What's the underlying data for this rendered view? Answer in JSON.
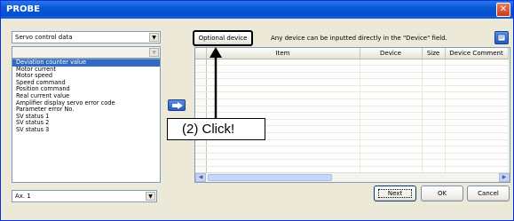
{
  "window": {
    "title": "PROBE",
    "close_glyph": "✕"
  },
  "left": {
    "category_combo": "Servo control data",
    "filter_combo": "",
    "items": [
      "Deviation counter value",
      "Motor current",
      "Motor speed",
      "Speed command",
      "Position command",
      "Real current value",
      "Amplifier display servo error code",
      "Parameter error No.",
      "SV status 1",
      "SV status 2",
      "SV status 3"
    ],
    "selected_index": 0,
    "axis_combo": "Ax. 1"
  },
  "toolbar": {
    "optional_device_label": "Optional device",
    "hint_text": "Any device can be inputted directly in the \"Device\" field."
  },
  "grid": {
    "columns": [
      "Item",
      "Device",
      "Size",
      "Device Comment"
    ],
    "row_count": 17
  },
  "buttons": {
    "next": "Next",
    "ok": "OK",
    "cancel": "Cancel"
  },
  "annotation": {
    "text": "(2) Click!"
  },
  "colors": {
    "titlebar": "#0a58d6",
    "selection": "#316ac5",
    "window_bg": "#ece9d8"
  }
}
